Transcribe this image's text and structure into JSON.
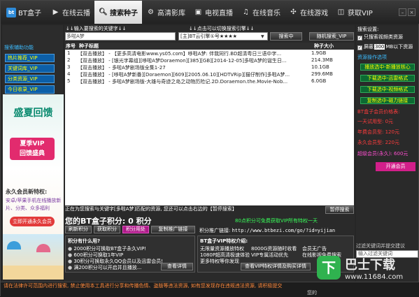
{
  "app": {
    "logo_text": "BT盒子",
    "logo_badge": "bt"
  },
  "tabs": [
    {
      "label": "在线云播",
      "icon": "cloud-play-icon"
    },
    {
      "label": "搜索种子",
      "icon": "search-icon"
    },
    {
      "label": "高清影库",
      "icon": "gear-film-icon"
    },
    {
      "label": "电视直播",
      "icon": "tv-icon"
    },
    {
      "label": "在线音乐",
      "icon": "person-music-icon"
    },
    {
      "label": "在线游戏",
      "icon": "fan-game-icon"
    },
    {
      "label": "获取VIP",
      "icon": "vip-icon"
    }
  ],
  "sidebar": {
    "title": "搜索辅助功能",
    "items": [
      "热片推荐_VIP",
      "关键词库_VIP",
      "分类资源_VIP",
      "今日收录_VIP"
    ]
  },
  "ad": {
    "title": "盛夏回馈",
    "vip_line1": "夏季VIP",
    "vip_line2": "回馈盛典",
    "sub": "永久会员新特权:",
    "desc": "安卓/苹果手机在线播放新片、分类、众多福利",
    "button": "立即开通永久会员"
  },
  "search": {
    "hint1": "↓↓输入要搜索的关键字↓↓",
    "hint2": "↓↓点击可以切换搜索引擎↓↓",
    "keyword": "多啦A梦",
    "engine": "[主]BT云引擎①号★★★★",
    "search_btn": "搜索中",
    "random_btn": "随机搜索_VIP"
  },
  "table": {
    "col_num": "序号",
    "col_title": "种子标题",
    "col_size": "种子大小",
    "rows": [
      {
        "n": "1",
        "title": "【双击播放】 - 【更多高清电影www.ys05.com】哆啦A梦: 伴我同行.BD超清粤日三语中字...",
        "size": "1.9GB"
      },
      {
        "n": "2",
        "title": "【双击播放】 - [银光字幕组][哆啦A梦Doraemon][385][GB][2014-12-05]多啦A梦的诞生日...",
        "size": "214.3MB"
      },
      {
        "n": "3",
        "title": "【双击播放】 - 多啦A梦剧场版全集1-27",
        "size": "10.1GB"
      },
      {
        "n": "4",
        "title": "【双击播放】 - [哆啦A梦新番][Doraemon][609][2005.06.10][HDTVRip][猫仔制作]多啦A梦...",
        "size": "299.6MB"
      },
      {
        "n": "5",
        "title": "【双击播放】 - 多啦A梦剧场版-大雄与奇迹之岛之动物历险记.2D.Doraemon.the.Movie-Nob...",
        "size": "6.0GB"
      }
    ]
  },
  "status": {
    "text": "正在为您搜索与关键字[多啦A梦]匹配的资源, 您还可以点击右边的【暂停搜索】",
    "pause_btn": "暂停搜索"
  },
  "points": {
    "label": "您的BT盒子积分: 0 积分",
    "promo": "80点积分可免费获取VIP所有特权一天",
    "refresh": "刷新积分",
    "get": "获取积分",
    "usage": "积分用处",
    "copy": "复制推广链接",
    "share_label": "积分推广链接:",
    "share_url": "http://www.btbezi.com/go/?id=yijian"
  },
  "box_left": {
    "title": "积分有什么用?",
    "items": [
      "2000积分可换取BT盒子永久VIP!",
      "600积分可换取1年VIP",
      "30积分可换取永久QQ会员以及迅雷会员!",
      "满200积分可以开启并且播放..."
    ],
    "button": "查看详情"
  },
  "box_right": {
    "title": "BT盒子VIP特权介绍:",
    "items": [
      "无限量资源播放特权",
      "8000G资源随时收看",
      "会员无广告",
      "1080P超高清极速体验",
      "VIP专属活动优先",
      "在线影视免费搜索",
      "更多特权等你发现"
    ],
    "button": "查看VIP特权详情及购买详情"
  },
  "right": {
    "settings": "搜索设置:",
    "opt1": "只搜索视频类资源",
    "opt2_pre": "屏蔽",
    "opt2_val": "300",
    "opt2_post": "MB以下资源",
    "ops_title": "资源操作选项",
    "btns": [
      "播放选中-新播放核心",
      "下载选中-迅雷格式",
      "下载选中-视频格式",
      "复制选中-磁力链接"
    ],
    "price_title": "BT盒子会员价格表:",
    "prices": [
      "一天试用型: 0元",
      "年费会员型: 120元",
      "永久会员型: 220元",
      "超级会员(永久): 600元"
    ],
    "vip_btn": "开通会员",
    "kw_label": "过滤关键词并提交建议",
    "kw_placeholder": "输入过滤关键词",
    "kw_text": "建议提交相关建议"
  },
  "bottom": {
    "warn": "请在法律许可范围内进行搜索, 禁止使用本工具进行分享和传播色情、盗版等违法资源, 如有您发现存在违规违法资源, 请积极提交",
    "ver": "您的"
  },
  "watermark": {
    "icon": "下",
    "title": "巴士下载",
    "url": "www.11684.com"
  },
  "colors": {
    "accent": "#2e8bd8",
    "side_btn": "#0c5fa8",
    "green_btn": "#0c6a32",
    "vip_pink": "#d21f8a"
  }
}
